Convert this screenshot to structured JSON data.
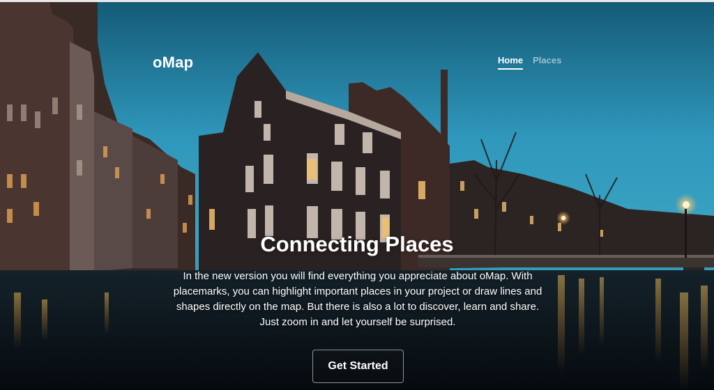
{
  "brand": {
    "name": "oMap"
  },
  "nav": {
    "items": [
      {
        "label": "Home",
        "active": true
      },
      {
        "label": "Places",
        "active": false
      }
    ]
  },
  "hero": {
    "title": "Connecting Places",
    "description": "In the new version you will find everything you appreciate about oMap. With placemarks, you can highlight important places in your project or draw lines and shapes directly on the map. But there is also a lot to discover, learn and share. Just zoom in and let yourself be surprised.",
    "cta_label": "Get Started",
    "background": "amsterdam-canal-night-photo"
  },
  "colors": {
    "sky_top": "#1b6f8e",
    "sky_mid": "#3fa9c9",
    "water": "#0a1620",
    "light_glow": "#ffcf6a"
  }
}
